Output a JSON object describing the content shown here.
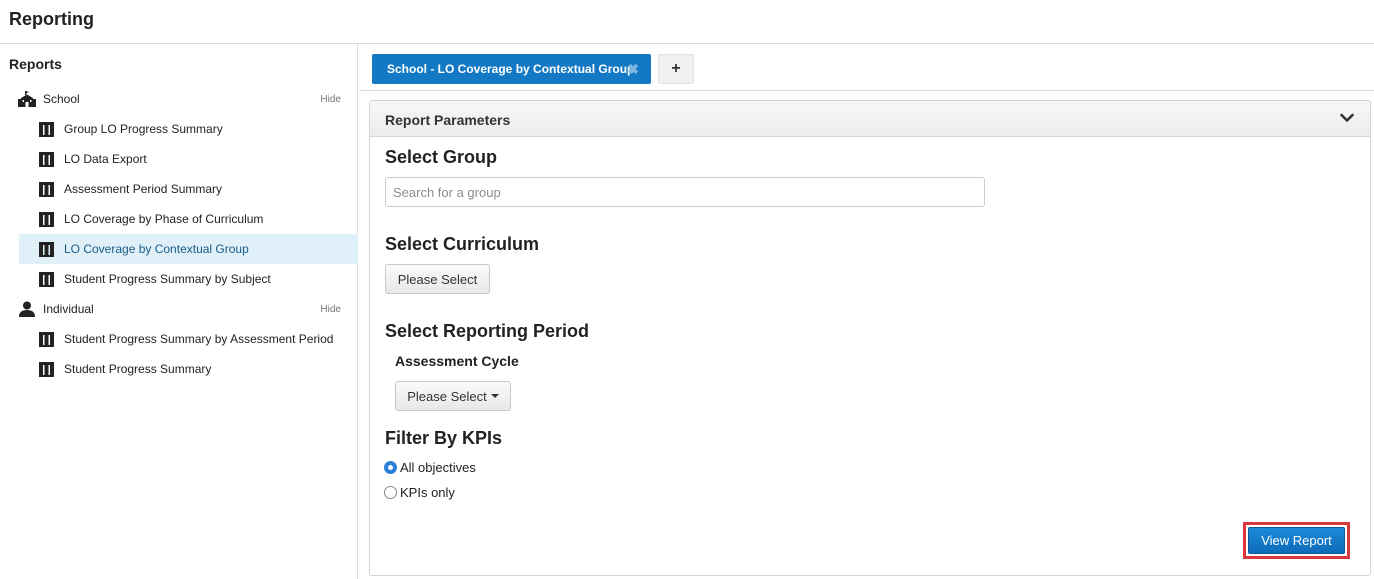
{
  "app": {
    "title": "Reporting"
  },
  "sidebar": {
    "heading": "Reports",
    "groups": [
      {
        "label": "School",
        "icon": "school-icon",
        "hide_label": "Hide",
        "items": [
          {
            "label": "Group LO Progress Summary",
            "icon": "report-icon",
            "active": false
          },
          {
            "label": "LO Data Export",
            "icon": "report-icon",
            "active": false
          },
          {
            "label": "Assessment Period Summary",
            "icon": "report-icon",
            "active": false
          },
          {
            "label": "LO Coverage by Phase of Curriculum",
            "icon": "report-icon",
            "active": false
          },
          {
            "label": "LO Coverage by Contextual Group",
            "icon": "report-icon",
            "active": true
          },
          {
            "label": "Student Progress Summary by Subject",
            "icon": "report-icon",
            "active": false
          }
        ]
      },
      {
        "label": "Individual",
        "icon": "user-icon",
        "hide_label": "Hide",
        "items": [
          {
            "label": "Student Progress Summary by Assessment Period",
            "icon": "report-icon",
            "active": false
          },
          {
            "label": "Student Progress Summary",
            "icon": "report-icon",
            "active": false
          }
        ]
      }
    ]
  },
  "tabs": {
    "active_label": "School - LO Coverage by Contextual Group",
    "close_icon": "close-icon",
    "add_label": "+"
  },
  "panel": {
    "title": "Report Parameters",
    "toggle_icon": "chevron-down-icon",
    "select_group": {
      "title": "Select Group",
      "placeholder": "Search for a group",
      "value": ""
    },
    "select_curriculum": {
      "title": "Select Curriculum",
      "button_label": "Please Select"
    },
    "reporting_period": {
      "title": "Select Reporting Period",
      "subtitle": "Assessment Cycle",
      "button_label": "Please Select"
    },
    "kpi_filter": {
      "title": "Filter By KPIs",
      "options": [
        {
          "label": "All objectives",
          "checked": true
        },
        {
          "label": "KPIs only",
          "checked": false
        }
      ]
    },
    "view_report_label": "View Report"
  },
  "colors": {
    "accent": "#1479c5",
    "active_row_bg": "#dff0f8",
    "highlight_border": "#d9363e"
  }
}
